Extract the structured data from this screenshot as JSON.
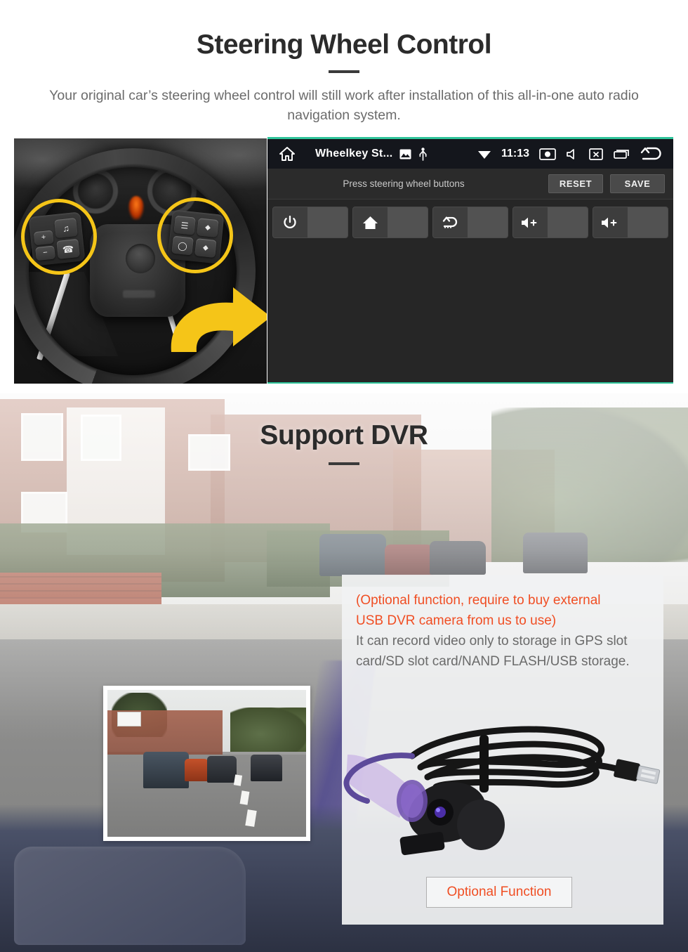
{
  "section_swc": {
    "title": "Steering Wheel Control",
    "subtitle": "Your original car’s steering wheel control will still work after installation of this all-in-one auto radio navigation system.",
    "wheel_photo": {
      "name": "steering-wheel-photo",
      "left_pod_keys": [
        "+",
        "−",
        "voice",
        "call"
      ],
      "right_pod_keys": [
        "list",
        "up",
        "circle",
        "down"
      ]
    },
    "ui_panel": {
      "statusbar": {
        "home_icon": "home-icon",
        "app_title": "Wheelkey St...",
        "image_icon": "image-icon",
        "usb_icon": "usb-icon",
        "wifi_icon": "wifi-icon",
        "clock": "11:13",
        "screenshot_icon": "screenshot-icon",
        "mute_icon": "mute-speaker-icon",
        "close-app_icon": "close-app-icon",
        "recents_icon": "recents-icon",
        "back_icon": "back-arrow-icon"
      },
      "instruction": "Press steering wheel buttons",
      "reset_label": "RESET",
      "save_label": "SAVE",
      "key_cells": [
        {
          "icon": "power-icon"
        },
        {
          "icon": "home-icon"
        },
        {
          "icon": "back-icon"
        },
        {
          "icon": "volume-up-icon"
        },
        {
          "icon": "volume-up-icon"
        }
      ],
      "accent_color": "#2fc39a"
    }
  },
  "section_dvr": {
    "title": "Support DVR",
    "info": {
      "highlight_line1": "(Optional function, require to buy external",
      "highlight_line2": "USB DVR camera from us to use)",
      "body": "It can record video only to storage in GPS slot card/SD slot card/NAND FLASH/USB storage.",
      "highlight_color": "#f04e23"
    },
    "optional_button": "Optional Function",
    "thumbnail_name": "dashcam-recording-thumbnail",
    "camera_name": "usb-dvr-camera-product-photo"
  }
}
